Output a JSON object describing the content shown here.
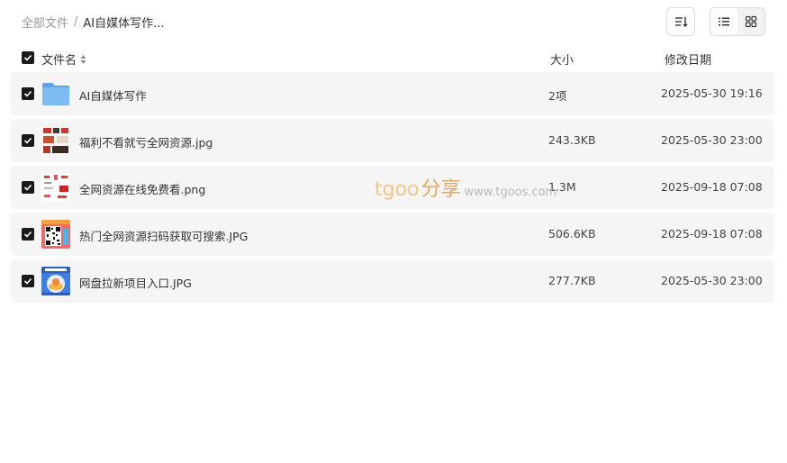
{
  "breadcrumb": {
    "root": "全部文件",
    "separator": "/",
    "current": "AI自媒体写作..."
  },
  "toolbar": {
    "sort_icon": "sort-icon",
    "list_view_icon": "list-view-icon",
    "grid_view_icon": "grid-view-icon",
    "active_view": "list"
  },
  "header": {
    "name": "文件名",
    "size": "大小",
    "date": "修改日期"
  },
  "files": [
    {
      "name": "AI自媒体写作",
      "size": "2项",
      "date": "2025-05-30 19:16",
      "type": "folder"
    },
    {
      "name": "福利不看就亏全网资源.jpg",
      "size": "243.3KB",
      "date": "2025-05-30 23:00",
      "type": "image"
    },
    {
      "name": "全网资源在线免费看.png",
      "size": "1.3M",
      "date": "2025-09-18 07:08",
      "type": "image"
    },
    {
      "name": "热门全网资源扫码获取可搜索.JPG",
      "size": "506.6KB",
      "date": "2025-09-18 07:08",
      "type": "qr-image"
    },
    {
      "name": "网盘拉新项目入口.JPG",
      "size": "277.7KB",
      "date": "2025-05-30 23:00",
      "type": "image"
    }
  ],
  "watermark": {
    "brand": "tgoo",
    "cn": "分享",
    "url": "www.tgoos.com"
  },
  "colors": {
    "row_bg": "#f5f5f5",
    "checkbox": "#1a1a1a",
    "folder": "#6fb2ec",
    "watermark": "#f2c58a"
  }
}
